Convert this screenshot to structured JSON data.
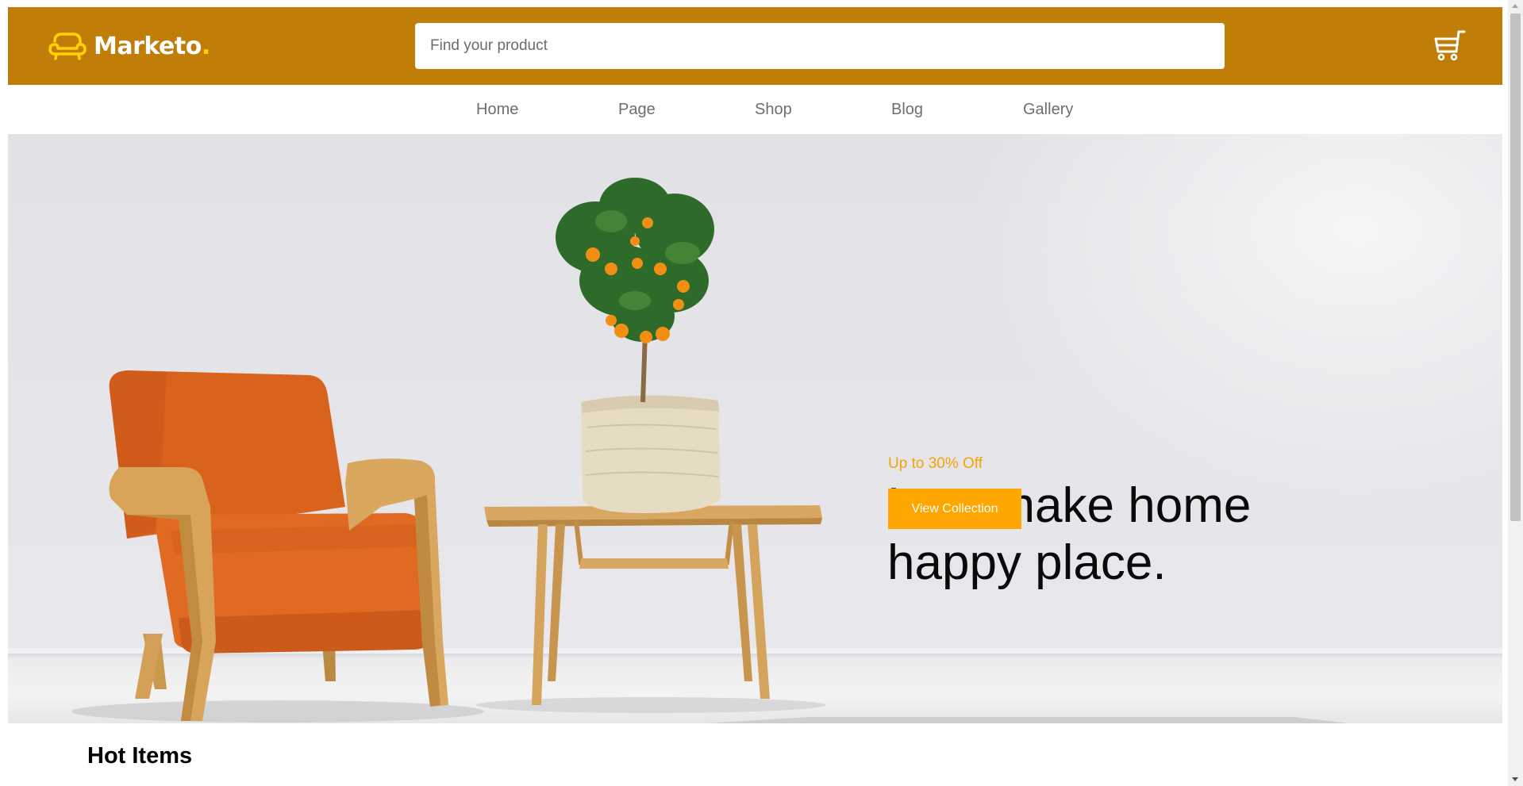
{
  "header": {
    "logo_text": "Marketo",
    "logo_dot": ".",
    "search_placeholder": "Find your product",
    "cart_icon": "shopping-cart-icon",
    "logo_icon": "sofa-icon",
    "background_color": "#c07d07"
  },
  "nav": {
    "items": [
      {
        "label": "Home"
      },
      {
        "label": "Page"
      },
      {
        "label": "Shop"
      },
      {
        "label": "Blog"
      },
      {
        "label": "Gallery"
      }
    ]
  },
  "hero": {
    "promo": "Up to 30% Off",
    "headline_line1": "Lets make home",
    "headline_line2": "happy place.",
    "cta_label": "View Collection",
    "accent_color": "#ffa600",
    "image_subject": "orange armchair beside wooden side table with potted orange tree"
  },
  "sections": {
    "hot_items_title": "Hot Items"
  }
}
